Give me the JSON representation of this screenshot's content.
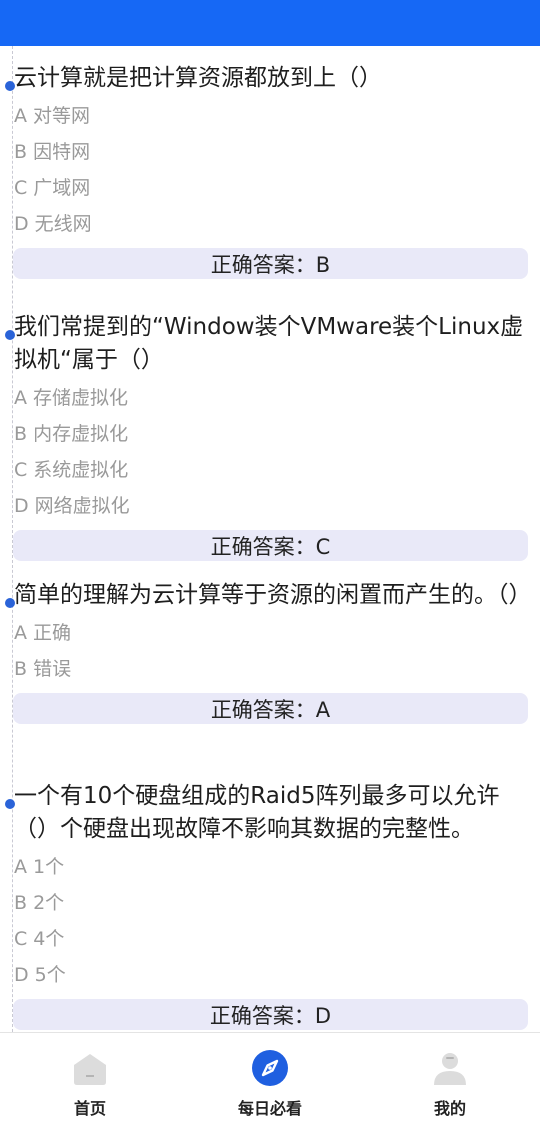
{
  "questions": [
    {
      "text": "云计算就是把计算资源都放到上（）",
      "options": [
        "A 对等网",
        "B 因特网",
        "C 广域网",
        "D 无线网"
      ],
      "answer": "正确答案：B"
    },
    {
      "text": "我们常提到的“Window装个VMware装个Linux虚拟机“属于（）",
      "options": [
        "A 存储虚拟化",
        "B 内存虚拟化",
        "C 系统虚拟化",
        "D 网络虚拟化"
      ],
      "answer": "正确答案：C"
    },
    {
      "text": "简单的理解为云计算等于资源的闲置而产生的。（）",
      "options": [
        "A 正确",
        "B 错误"
      ],
      "answer": "正确答案：A"
    },
    {
      "text": "一个有10个硬盘组成的Raid5阵列最多可以允许（）个硬盘出现故障不影响其数据的完整性。",
      "options": [
        "A 1个",
        "B 2个",
        "C 4个",
        "D 5个"
      ],
      "answer": "正确答案：D"
    }
  ],
  "tabbar": {
    "items": [
      {
        "label": "首页",
        "icon": "home-icon",
        "active": false
      },
      {
        "label": "每日必看",
        "icon": "compass-icon",
        "active": true
      },
      {
        "label": "我的",
        "icon": "user-icon",
        "active": false
      }
    ]
  },
  "colors": {
    "header": "#1668f5",
    "accent": "#1f5fe0",
    "answer_bg": "#e9e9f8",
    "option_text": "#9a9a9a"
  }
}
